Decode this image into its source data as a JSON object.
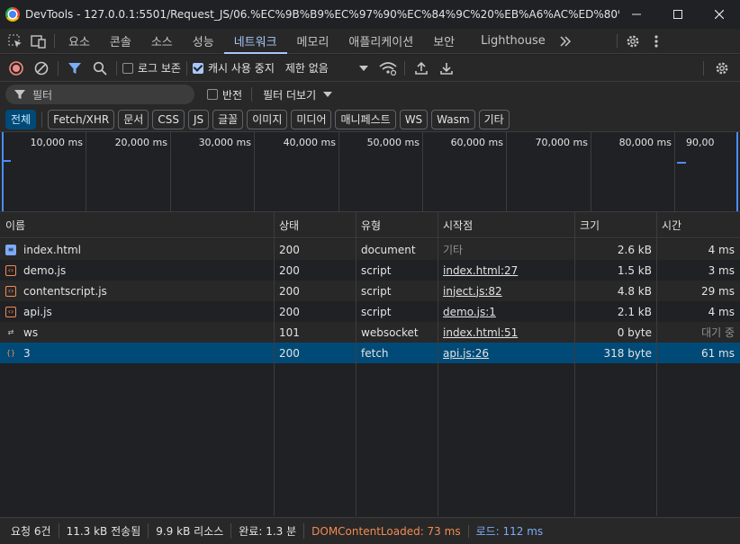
{
  "window": {
    "title": "DevTools - 127.0.0.1:5501/Request_JS/06.%EC%9B%B9%EC%97%90%EC%84%9C%20%EB%A6%AC%ED%80%98%EC%8..."
  },
  "tabs": [
    {
      "label": "요소"
    },
    {
      "label": "콘솔"
    },
    {
      "label": "소스"
    },
    {
      "label": "성능"
    },
    {
      "label": "네트워크"
    },
    {
      "label": "메모리"
    },
    {
      "label": "애플리케이션"
    },
    {
      "label": "보안"
    },
    {
      "label": "Lighthouse"
    }
  ],
  "toolbar": {
    "preserve_log": "로그 보존",
    "disable_cache": "캐시 사용 중지",
    "throttling": "제한 없음"
  },
  "filter": {
    "placeholder": "필터",
    "invert": "반전",
    "more_filters": "필터 더보기"
  },
  "type_filters": [
    "전체",
    "Fetch/XHR",
    "문서",
    "CSS",
    "JS",
    "글꼴",
    "이미지",
    "미디어",
    "매니페스트",
    "WS",
    "Wasm",
    "기타"
  ],
  "overview": {
    "ticks": [
      "10,000 ms",
      "20,000 ms",
      "30,000 ms",
      "40,000 ms",
      "50,000 ms",
      "60,000 ms",
      "70,000 ms",
      "80,000 ms",
      "90,00"
    ]
  },
  "table": {
    "columns": [
      "이름",
      "상태",
      "유형",
      "시작점",
      "크기",
      "시간"
    ],
    "rows": [
      {
        "name": "index.html",
        "icon": "document-icon",
        "status": "200",
        "type": "document",
        "initiator": "기타",
        "size": "2.6 kB",
        "time": "4 ms"
      },
      {
        "name": "demo.js",
        "icon": "script-icon",
        "status": "200",
        "type": "script",
        "initiator": "index.html:27",
        "size": "1.5 kB",
        "time": "3 ms"
      },
      {
        "name": "contentscript.js",
        "icon": "script-icon",
        "status": "200",
        "type": "script",
        "initiator": "inject.js:82",
        "size": "4.8 kB",
        "time": "29 ms"
      },
      {
        "name": "api.js",
        "icon": "script-icon",
        "status": "200",
        "type": "script",
        "initiator": "demo.js:1",
        "size": "2.1 kB",
        "time": "4 ms"
      },
      {
        "name": "ws",
        "icon": "websocket-icon",
        "status": "101",
        "type": "websocket",
        "initiator": "index.html:51",
        "size": "0 byte",
        "time": "대기 중"
      },
      {
        "name": "3",
        "icon": "fetch-icon",
        "status": "200",
        "type": "fetch",
        "initiator": "api.js:26",
        "size": "318 byte",
        "time": "61 ms"
      }
    ]
  },
  "status": {
    "requests": "요청 6건",
    "transferred": "11.3 kB 전송됨",
    "resources": "9.9 kB 리소스",
    "finish": "완료: 1.3 분",
    "dom": "DOMContentLoaded: 73 ms",
    "load": "로드: 112 ms"
  },
  "colors": {
    "accent": "#a8c7fa",
    "selected_row": "#004a77",
    "record_red": "#f28b82",
    "dom_orange": "#f28b54",
    "load_blue": "#7cacf8"
  }
}
